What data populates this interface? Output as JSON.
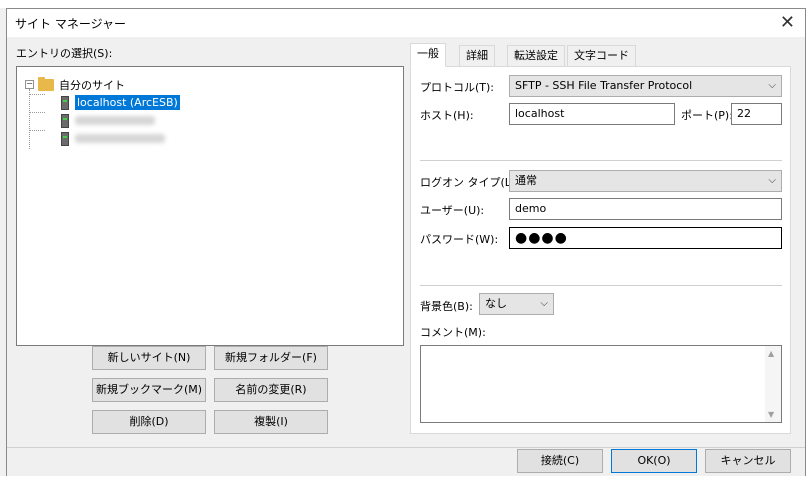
{
  "dialog": {
    "title": "サイト マネージャー"
  },
  "tree": {
    "label": "エントリの選択(S):",
    "root": "自分のサイト",
    "sites": [
      {
        "name": "localhost (ArcESB)"
      }
    ]
  },
  "left_buttons": {
    "new_site": "新しいサイト(N)",
    "new_folder": "新規フォルダー(F)",
    "new_bookmark": "新規ブックマーク(M)",
    "rename": "名前の変更(R)",
    "delete": "削除(D)",
    "duplicate": "複製(I)"
  },
  "tabs": [
    {
      "label": "一般"
    },
    {
      "label": "詳細"
    },
    {
      "label": "転送設定"
    },
    {
      "label": "文字コード"
    }
  ],
  "general": {
    "protocol_label": "プロトコル(T):",
    "protocol_value": "SFTP - SSH File Transfer Protocol",
    "host_label": "ホスト(H):",
    "host_value": "localhost",
    "port_label": "ポート(P):",
    "port_value": "22",
    "logon_label": "ログオン タイプ(L):",
    "logon_value": "通常",
    "user_label": "ユーザー(U):",
    "user_value": "demo",
    "password_label": "パスワード(W):",
    "password_value": "●●●●",
    "bgcolor_label": "背景色(B):",
    "bgcolor_value": "なし",
    "comment_label": "コメント(M):"
  },
  "footer": {
    "connect": "接続(C)",
    "ok": "OK(O)",
    "cancel": "キャンセル"
  }
}
